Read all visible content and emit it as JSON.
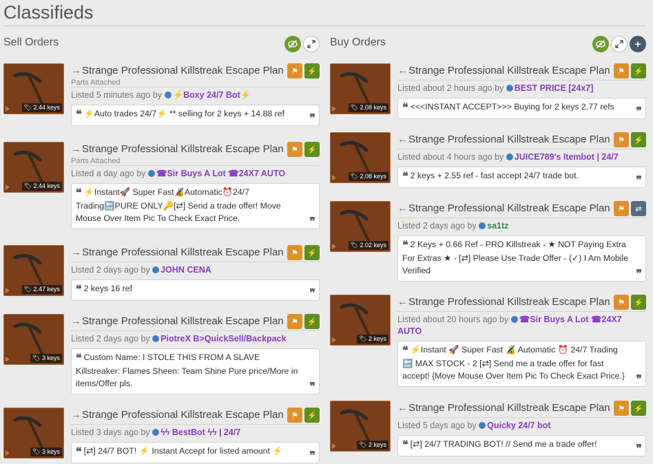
{
  "page": {
    "title": "Classifieds"
  },
  "sell": {
    "title": "Sell Orders",
    "listings": [
      {
        "name": "Strange Professional Killstreak Escape Plan",
        "sub": "Parts Attached",
        "time": "Listed 5 minutes ago by",
        "user": "⚡Boxy 24/7 Bot⚡",
        "price": "2.44 keys",
        "comment": "⚡Auto trades 24/7⚡ ** selling for 2 keys + 14.88 ref"
      },
      {
        "name": "Strange Professional Killstreak Escape Plan",
        "sub": "Parts Attached",
        "time": "Listed a day ago by",
        "user": "☎Sir Buys A Lot ☎24X7 AUTO",
        "price": "2.44 keys",
        "comment": "⚡Instant🚀 Super Fast🔏Automatic⏰24/7 Trading🔚PURE ONLY🔑[⇄] Send a trade offer! Move Mouse Over Item Pic To Check Exact Price."
      },
      {
        "name": "Strange Professional Killstreak Escape Plan",
        "sub": "",
        "time": "Listed 2 days ago by",
        "user": "JOHN CENA",
        "price": "2.47 keys",
        "comment": "2 keys 16 ref"
      },
      {
        "name": "Strange Professional Killstreak Escape Plan",
        "sub": "",
        "time": "Listed 2 days ago by",
        "user": "PiotreX B>QuickSell/Backpack",
        "price": "3 keys",
        "comment": "Custom Name: I STOLE THIS FROM A SLAVE Killstreaker: Flames Sheen: Team Shine Pure price/More in items/Offer pls."
      },
      {
        "name": "Strange Professional Killstreak Escape Plan",
        "sub": "",
        "time": "Listed 3 days ago by",
        "user": "ϟϟ BestBot ϟϟ | 24/7",
        "price": "3 keys",
        "comment": "[⇄] 24/7 BOT! ⚡ Instant Accept for listed amount ⚡"
      }
    ]
  },
  "buy": {
    "title": "Buy Orders",
    "listings": [
      {
        "name": "Strange Professional Killstreak Escape Plan",
        "time": "Listed about 2 hours ago by",
        "user": "BEST PRICE [24x7]",
        "user_color": "#8a3dc3",
        "price": "2.08 keys",
        "comment": "<<<INSTANT ACCEPT>>> Buying for 2 keys 2.77 refs"
      },
      {
        "name": "Strange Professional Killstreak Escape Plan",
        "time": "Listed about 4 hours ago by",
        "user": "JUICE789's Itembot | 24/7",
        "user_color": "#8a3dc3",
        "price": "2.08 keys",
        "comment": "2 keys + 2.55 ref - fast accept 24/7 trade bot."
      },
      {
        "name": "Strange Professional Killstreak Escape Plan",
        "time": "Listed 2 days ago by",
        "user": "sa1tz",
        "user_color": "#2e8b57",
        "price": "2.02 keys",
        "comment": "2 Keys + 0.66 Ref - PRO Killstreak - ★ NOT Paying Extra For Extras ★ - [⇄] Please Use Trade Offer - (✓) I Am Mobile Verified"
      },
      {
        "name": "Strange Professional Killstreak Escape Plan",
        "time": "Listed about 20 hours ago by",
        "user": "☎Sir Buys A Lot ☎24X7 AUTO",
        "user_color": "#8a3dc3",
        "price": "2 keys",
        "comment": "⚡Instant 🚀 Super Fast 🔏 Automatic ⏰ 24/7 Trading 🔚 MAX STOCK - 2 [⇄] Send me a trade offer for fast accept! {Move Mouse Over Item Pic To Check Exact Price.}"
      },
      {
        "name": "Strange Professional Killstreak Escape Plan",
        "time": "Listed 5 days ago by",
        "user": "Quicky 24/7 bot",
        "user_color": "#8a3dc3",
        "price": "2 keys",
        "comment": "[⇄] 24/7 TRADING BOT! // Send me a trade offer!"
      }
    ]
  },
  "icons": {
    "arrow_sell": "→",
    "arrow_buy": "←",
    "flag": "⚑",
    "bolt": "⚡",
    "swap": "⇄",
    "quote_open": "❝",
    "quote_close": "❞"
  },
  "colors": {
    "accent_green": "#5c8f22",
    "accent_orange": "#e0902a",
    "user_purple": "#8a3dc3",
    "buy_blue": "#3f7fc1"
  }
}
